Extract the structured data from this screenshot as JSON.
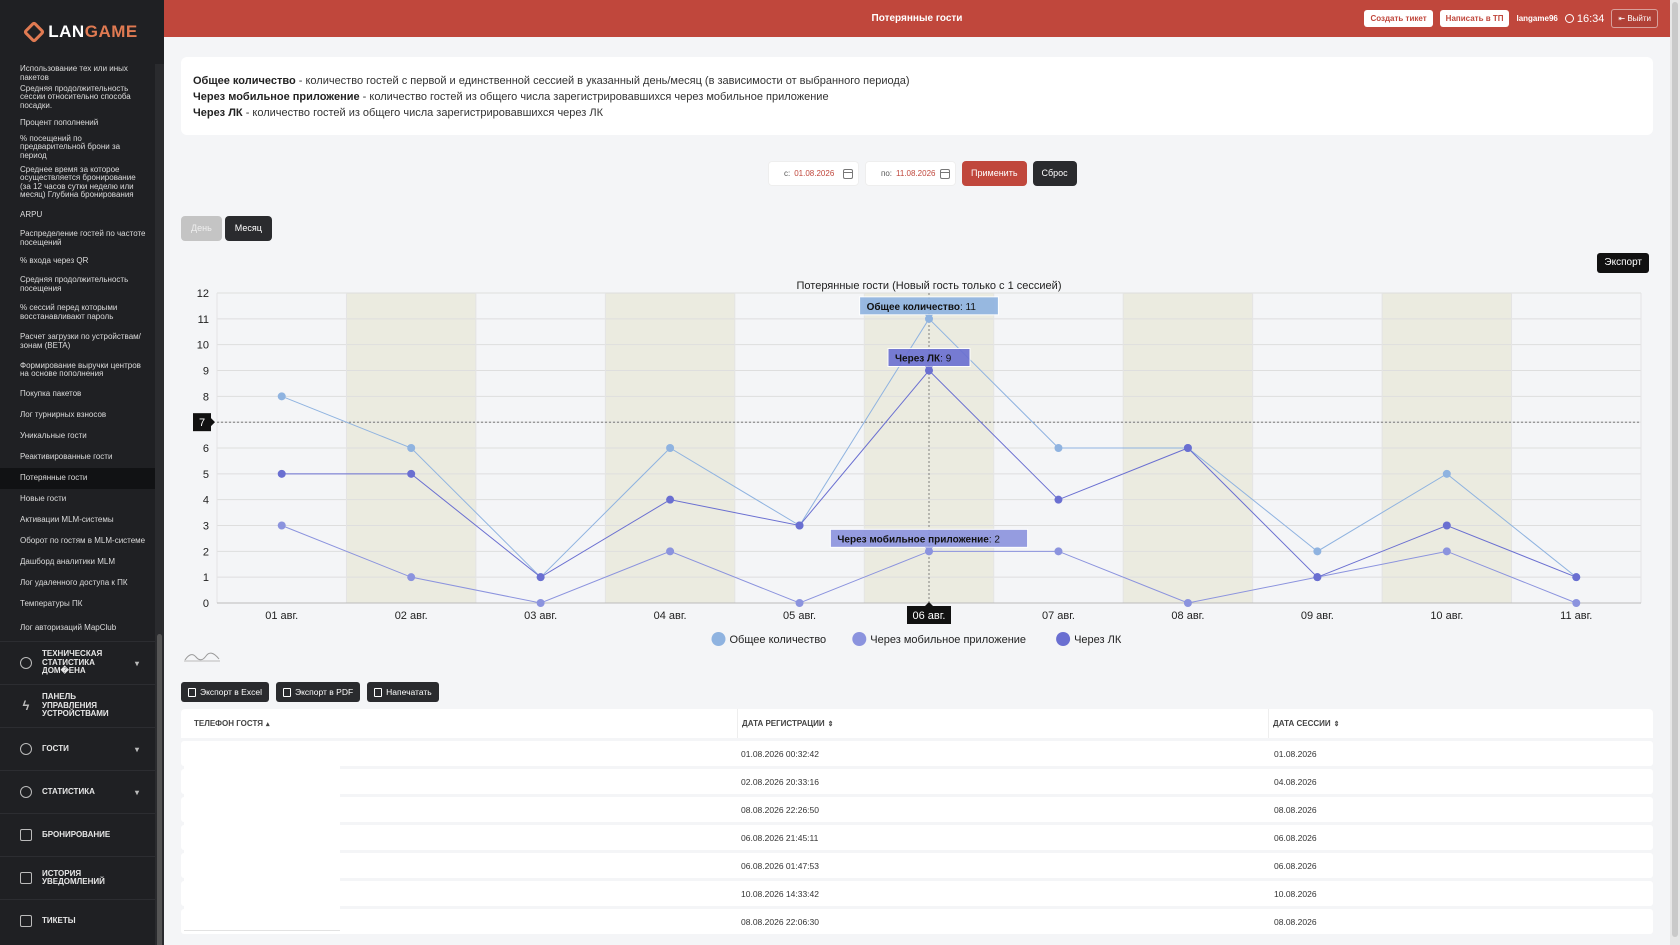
{
  "app": {
    "logo_prefix": "LAN",
    "logo_suffix": "GAME"
  },
  "header": {
    "title": "Потерянные гости",
    "create_ticket": "Создать тикет",
    "write_support": "Написать в ТП",
    "user": "langame96",
    "time": "16:34",
    "logout": "Выйти"
  },
  "sidebar": {
    "reports": [
      {
        "label": "Использование тех или иных пакетов",
        "h": 19
      },
      {
        "label": "Средняя продолжительность сессии относительно способа посадки.",
        "h": 29
      },
      {
        "label": "Процент пополнений",
        "h": 22
      },
      {
        "label": "% посещений по предварительной брони за период",
        "h": 27
      },
      {
        "label": "Среднее время за которое осуществляется бронирование (за 12 часов сутки неделю или месяц) Глубина бронирования",
        "h": 43
      },
      {
        "label": "ARPU",
        "h": 22
      },
      {
        "label": "Распределение гостей по частоте посещений",
        "h": 25
      },
      {
        "label": "% входа через QR",
        "h": 20
      },
      {
        "label": "Средняя продолжительность посещения",
        "h": 27
      },
      {
        "label": "% сессий перед которыми восстанавливают пароль",
        "h": 29
      },
      {
        "label": "Расчет загрузки по устройствам/зонам (BETA)",
        "h": 29
      },
      {
        "label": "Формирование выручки центров на основе пополнения",
        "h": 28
      },
      {
        "label": "Покупка пакетов",
        "h": 21
      },
      {
        "label": "Лог турнирных взносов",
        "h": 21
      },
      {
        "label": "Уникальные гости",
        "h": 21
      },
      {
        "label": "Реактивированные гости",
        "h": 21
      },
      {
        "label": "Потерянные гости",
        "h": 21,
        "active": true
      },
      {
        "label": "Новые гости",
        "h": 21
      },
      {
        "label": "Активации MLM-системы",
        "h": 21
      },
      {
        "label": "Оборот по гостям в MLM-системе",
        "h": 21
      },
      {
        "label": "Дашборд аналитики MLM",
        "h": 21
      },
      {
        "label": "Лог удаленного доступа к ПК",
        "h": 21
      },
      {
        "label": "Температуры ПК",
        "h": 21
      },
      {
        "label": "Лог авторизаций MapClub",
        "h": 26
      }
    ],
    "groups": [
      {
        "label": "ТЕХНИЧЕСКАЯ СТАТИСТИКА ДОМ�ЕНА",
        "icon": "pie-chart-icon",
        "chevron": "▾",
        "h": 43
      },
      {
        "label": "ПАНЕЛЬ УПРАВЛЕНИЯ УСТРОЙСТВАМИ",
        "icon": "bolt-icon",
        "chevron": "",
        "h": 43
      },
      {
        "label": "ГОСТИ",
        "icon": "users-icon",
        "chevron": "▾",
        "h": 43
      },
      {
        "label": "СТАТИСТИКА",
        "icon": "pie-chart-icon",
        "chevron": "▾",
        "h": 43
      },
      {
        "label": "БРОНИРОВАНИЕ",
        "icon": "edit-icon",
        "chevron": "",
        "h": 43
      },
      {
        "label": "ИСТОРИЯ УВЕДОМЛЕНИЙ",
        "icon": "notifications-icon",
        "chevron": "",
        "h": 43
      },
      {
        "label": "ТИКЕТЫ",
        "icon": "tickets-icon",
        "chevron": "",
        "h": 43
      }
    ]
  },
  "info": {
    "total_term": "Общее количество",
    "total_desc": " - количество гостей с первой и единственной сессией в указанный день/месяц (в зависимости от выбранного периода)",
    "mobile_term": "Через мобильное приложение",
    "mobile_desc": " - количество гостей из общего числа зарегистрировавшихся через мобильное приложение",
    "lk_term": "Через ЛК",
    "lk_desc": " - количество гостей из общего числа зарегистрировавшихся через ЛК"
  },
  "filters": {
    "from_label": "с:",
    "from_value": "01.08.2026",
    "to_label": "по:",
    "to_value": "11.08.2026",
    "apply": "Применить",
    "reset": "Сброс"
  },
  "period": {
    "day": "День",
    "month": "Месяц"
  },
  "export_label": "Экспорт",
  "chart_data": {
    "type": "line",
    "title": "Потерянные гости (Новый гость только с 1 сессией)",
    "categories": [
      "01 авг.",
      "02 авг.",
      "03 авг.",
      "04 авг.",
      "05 авг.",
      "06 авг.",
      "07 авг.",
      "08 авг.",
      "09 авг.",
      "10 авг.",
      "11 авг."
    ],
    "ylim": [
      0,
      12
    ],
    "yticks": [
      0,
      1,
      2,
      3,
      4,
      5,
      6,
      7,
      8,
      9,
      10,
      11,
      12
    ],
    "grid": true,
    "legend_position": "bottom",
    "series": [
      {
        "name": "Общее количество",
        "color": "#8fb3e0",
        "values": [
          8,
          6,
          1,
          6,
          3,
          11,
          6,
          6,
          2,
          5,
          1
        ]
      },
      {
        "name": "Через мобильное приложение",
        "color": "#8b93de",
        "values": [
          3,
          1,
          0,
          2,
          0,
          2,
          2,
          0,
          1,
          2,
          0
        ]
      },
      {
        "name": "Через ЛК",
        "color": "#6a6fd1",
        "values": [
          5,
          5,
          1,
          4,
          3,
          9,
          4,
          6,
          1,
          3,
          1
        ]
      }
    ],
    "hover": {
      "category": "06 авг.",
      "y_marker": "7",
      "tooltips": [
        {
          "label": "Общее количество",
          "value": "11"
        },
        {
          "label": "Через ЛК",
          "value": "9"
        },
        {
          "label": "Через мобильное приложение",
          "value": "2"
        }
      ]
    }
  },
  "table_tools": {
    "excel": "Экспорт в Excel",
    "pdf": "Экспорт в PDF",
    "print": "Напечатать"
  },
  "table": {
    "columns": [
      "ТЕЛЕФОН ГОСТЯ",
      "ДАТА РЕГИСТРАЦИИ",
      "ДАТА СЕССИИ"
    ],
    "sort_icons": [
      "▴",
      "⇕",
      "⇕"
    ],
    "rows": [
      {
        "reg": "01.08.2026 00:32:42",
        "session": "01.08.2026"
      },
      {
        "reg": "02.08.2026 20:33:16",
        "session": "04.08.2026"
      },
      {
        "reg": "08.08.2026 22:26:50",
        "session": "08.08.2026"
      },
      {
        "reg": "06.08.2026 21:45:11",
        "session": "06.08.2026"
      },
      {
        "reg": "06.08.2026 01:47:53",
        "session": "06.08.2026"
      },
      {
        "reg": "10.08.2026 14:33:42",
        "session": "10.08.2026"
      },
      {
        "reg": "08.08.2026 22:06:30",
        "session": "08.08.2026"
      }
    ]
  }
}
